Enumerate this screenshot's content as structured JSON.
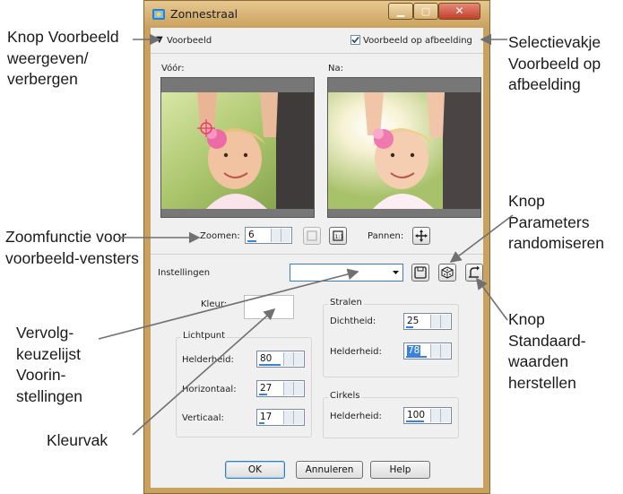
{
  "window": {
    "title": "Zonnestraal",
    "preview_toggle_label": "Voorbeeld",
    "preview_on_image_label": "Voorbeeld op afbeelding",
    "preview_on_image_checked": true,
    "before_label": "Vóór:",
    "after_label": "Na:",
    "zoom_label": "Zoomen:",
    "zoom_value": "6",
    "pan_label": "Pannen:",
    "presets_label": "Instellingen",
    "presets_value": "",
    "color_label": "Kleur:",
    "color_value": "#ffffff",
    "lightspot": {
      "title": "Lichtpunt",
      "brightness_label": "Helderheid:",
      "brightness_value": "80",
      "horizontal_label": "Horizontaal:",
      "horizontal_value": "27",
      "vertical_label": "Verticaal:",
      "vertical_value": "17"
    },
    "rays": {
      "title": "Stralen",
      "density_label": "Dichtheid:",
      "density_value": "25",
      "brightness_label": "Helderheid:",
      "brightness_value": "78"
    },
    "circles": {
      "title": "Cirkels",
      "brightness_label": "Helderheid:",
      "brightness_value": "100"
    },
    "buttons": {
      "ok": "OK",
      "cancel": "Annuleren",
      "help": "Help"
    }
  },
  "callouts": {
    "toggle_preview": "Knop Voorbeeld weergeven/ verbergen",
    "preview_checkbox": "Selectievakje Voorbeeld op afbeelding",
    "zoom": "Zoomfunctie voor voorbeeld-vensters",
    "presets": "Vervolg-keuzelijst Voorin-stellingen",
    "color_box": "Kleurvak",
    "randomize": "Knop Parameters randomiseren",
    "reset": "Knop Standaard-waarden herstellen"
  },
  "colors": {
    "titlebar": "#caa15e",
    "dialog": "#f0f0f0",
    "accent": "#3b83d8"
  }
}
